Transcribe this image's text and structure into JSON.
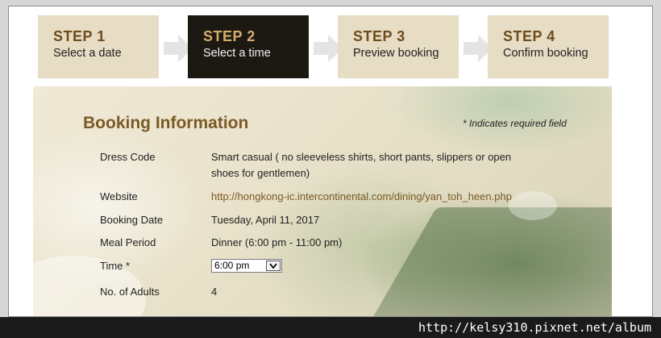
{
  "steps": [
    {
      "title": "STEP 1",
      "subtitle": "Select a date",
      "active": false
    },
    {
      "title": "STEP 2",
      "subtitle": "Select a time",
      "active": true
    },
    {
      "title": "STEP 3",
      "subtitle": "Preview booking",
      "active": false
    },
    {
      "title": "STEP 4",
      "subtitle": "Confirm booking",
      "active": false
    }
  ],
  "booking": {
    "title": "Booking Information",
    "required_note": "* Indicates required field",
    "fields": {
      "dress_code": {
        "label": "Dress Code",
        "value": "Smart casual ( no sleeveless shirts, short pants, slippers or open shoes for gentlemen)"
      },
      "website": {
        "label": "Website",
        "value": "http://hongkong-ic.intercontinental.com/dining/yan_toh_heen.php"
      },
      "booking_date": {
        "label": "Booking Date",
        "value": "Tuesday, April 11, 2017"
      },
      "meal_period": {
        "label": "Meal Period",
        "value": "Dinner  (6:00 pm - 11:00 pm)"
      },
      "time": {
        "label": "Time *",
        "selected": "6:00 pm"
      },
      "adults": {
        "label": "No. of Adults",
        "value": "4"
      }
    }
  },
  "watermark": "http://kelsy310.pixnet.net/album",
  "colors": {
    "step_bg": "#e7dcc4",
    "step_active_bg": "#1c1812",
    "step_title": "#6e4d1c",
    "step_active_title": "#d5ad6c",
    "heading": "#7b5a25"
  }
}
